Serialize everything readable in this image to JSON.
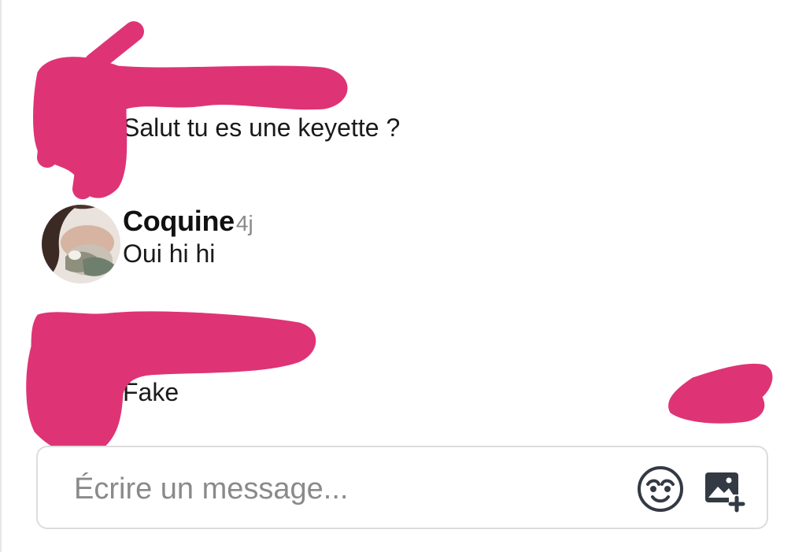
{
  "messages": [
    {
      "author": "",
      "age": "",
      "text": "Salut tu es une keyette ?"
    },
    {
      "author": "Coquine",
      "age": "4j",
      "text": "Oui hi hi"
    },
    {
      "author": "",
      "age": "",
      "text": "Fake"
    }
  ],
  "composer": {
    "placeholder": "Écrire un message...",
    "value": "",
    "emoji_icon": "emoji-face-icon",
    "image_icon": "add-image-icon"
  },
  "colors": {
    "redaction": "#de3475",
    "icon": "#333a44",
    "border": "#dcdcdc",
    "muted_text": "#8a8a8a"
  }
}
